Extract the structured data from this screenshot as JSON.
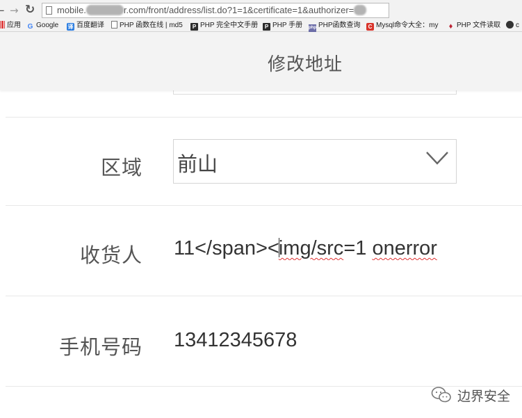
{
  "browser": {
    "url_prefix": "mobile.",
    "url_middle": "r.com/front/address/list.do?1=1&certificate=1&authorizer=",
    "bookmarks": [
      {
        "label": "应用",
        "icon": "apps-icon"
      },
      {
        "label": "Google",
        "icon": "google-icon"
      },
      {
        "label": "百度翻译",
        "icon": "translate-icon"
      },
      {
        "label": "PHP 函数在线 | md5",
        "icon": "page-icon"
      },
      {
        "label": "PHP 完全中文手册",
        "icon": "php-icon"
      },
      {
        "label": "PHP 手册",
        "icon": "php-icon"
      },
      {
        "label": "PHP函数查询",
        "icon": "phpnet-icon"
      },
      {
        "label": "Mysql命令大全：my",
        "icon": "c-icon"
      },
      {
        "label": "PHP 文件读取",
        "icon": "feather-icon"
      },
      {
        "label": "c",
        "icon": "chrome-icon"
      }
    ]
  },
  "header": {
    "title": "修改地址"
  },
  "form": {
    "region": {
      "label": "区域",
      "value": "前山"
    },
    "receiver": {
      "label": "收货人",
      "value_before_caret": "11</span><",
      "value_after_caret_underlined_1": "img/src",
      "value_mid": "=1 ",
      "value_after_caret_underlined_2": "onerror"
    },
    "phone": {
      "label": "手机号码",
      "value": "13412345678"
    }
  },
  "watermark": {
    "text": "边界安全"
  }
}
